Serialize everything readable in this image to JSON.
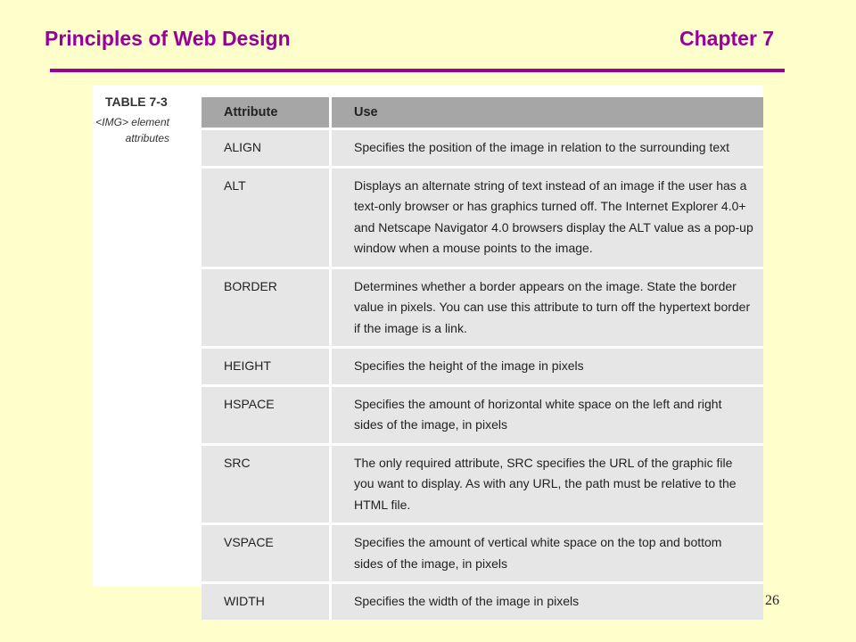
{
  "header": {
    "title": "Principles of Web Design",
    "chapter": "Chapter 7"
  },
  "table": {
    "label": "TABLE 7-3",
    "caption": "<IMG> element attributes",
    "columns": [
      "Attribute",
      "Use"
    ],
    "rows": [
      {
        "attribute": "ALIGN",
        "use": "Specifies the position of the image in relation to the surrounding text"
      },
      {
        "attribute": "ALT",
        "use": "Displays an alternate string of text instead of an image if the user has a text-only browser or has graphics turned off. The Internet Explorer 4.0+ and Netscape Navigator 4.0 browsers display the ALT value as a pop-up window when a mouse points to the image."
      },
      {
        "attribute": "BORDER",
        "use": "Determines whether a border appears on the image. State the border value in pixels. You can use this attribute to turn off the hypertext border if the image is a link."
      },
      {
        "attribute": "HEIGHT",
        "use": "Specifies the height of the image in pixels"
      },
      {
        "attribute": "HSPACE",
        "use": "Specifies the amount of horizontal white space on the left and right sides of the image, in pixels"
      },
      {
        "attribute": "SRC",
        "use": "The only required attribute, SRC specifies the URL of the graphic file you want to display. As with any URL, the path must be relative to the HTML file."
      },
      {
        "attribute": "VSPACE",
        "use": "Specifies the amount of vertical white space on the top and bottom sides of the image, in pixels"
      },
      {
        "attribute": "WIDTH",
        "use": "Specifies the width of the image in pixels"
      }
    ]
  },
  "page_number": "26",
  "colors": {
    "background": "#ffffcc",
    "accent": "#990099",
    "header_row": "#a6a6a6",
    "body_row": "#e6e6e6"
  }
}
